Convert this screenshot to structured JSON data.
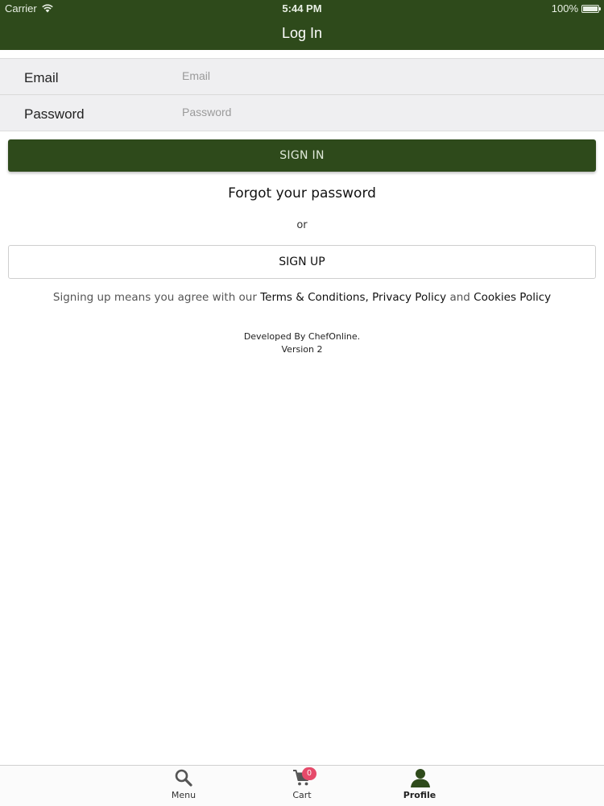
{
  "status_bar": {
    "carrier": "Carrier",
    "time": "5:44 PM",
    "battery": "100%"
  },
  "nav": {
    "title": "Log In"
  },
  "form": {
    "email_label": "Email",
    "email_placeholder": "Email",
    "email_value": "",
    "password_label": "Password",
    "password_placeholder": "Password",
    "password_value": ""
  },
  "actions": {
    "sign_in": "SIGN IN",
    "forgot": "Forgot your password",
    "or": "or",
    "sign_up": "SIGN UP"
  },
  "agreement": {
    "prefix": "Signing up means you agree with our ",
    "terms": "Terms & Conditions,",
    "privacy": "Privacy Policy",
    "and": "and",
    "cookies": "Cookies Policy"
  },
  "footer": {
    "developed_by": "Developed By ChefOnline.",
    "version": "Version 2"
  },
  "tabbar": {
    "tabs": [
      {
        "label": "Menu",
        "icon": "search-icon"
      },
      {
        "label": "Cart",
        "icon": "cart-icon",
        "badge": "0"
      },
      {
        "label": "Profile",
        "icon": "profile-icon",
        "active": true
      }
    ]
  },
  "colors": {
    "brand": "#2e4a1b",
    "badge": "#e64a6a",
    "form_background": "#efeff1"
  }
}
